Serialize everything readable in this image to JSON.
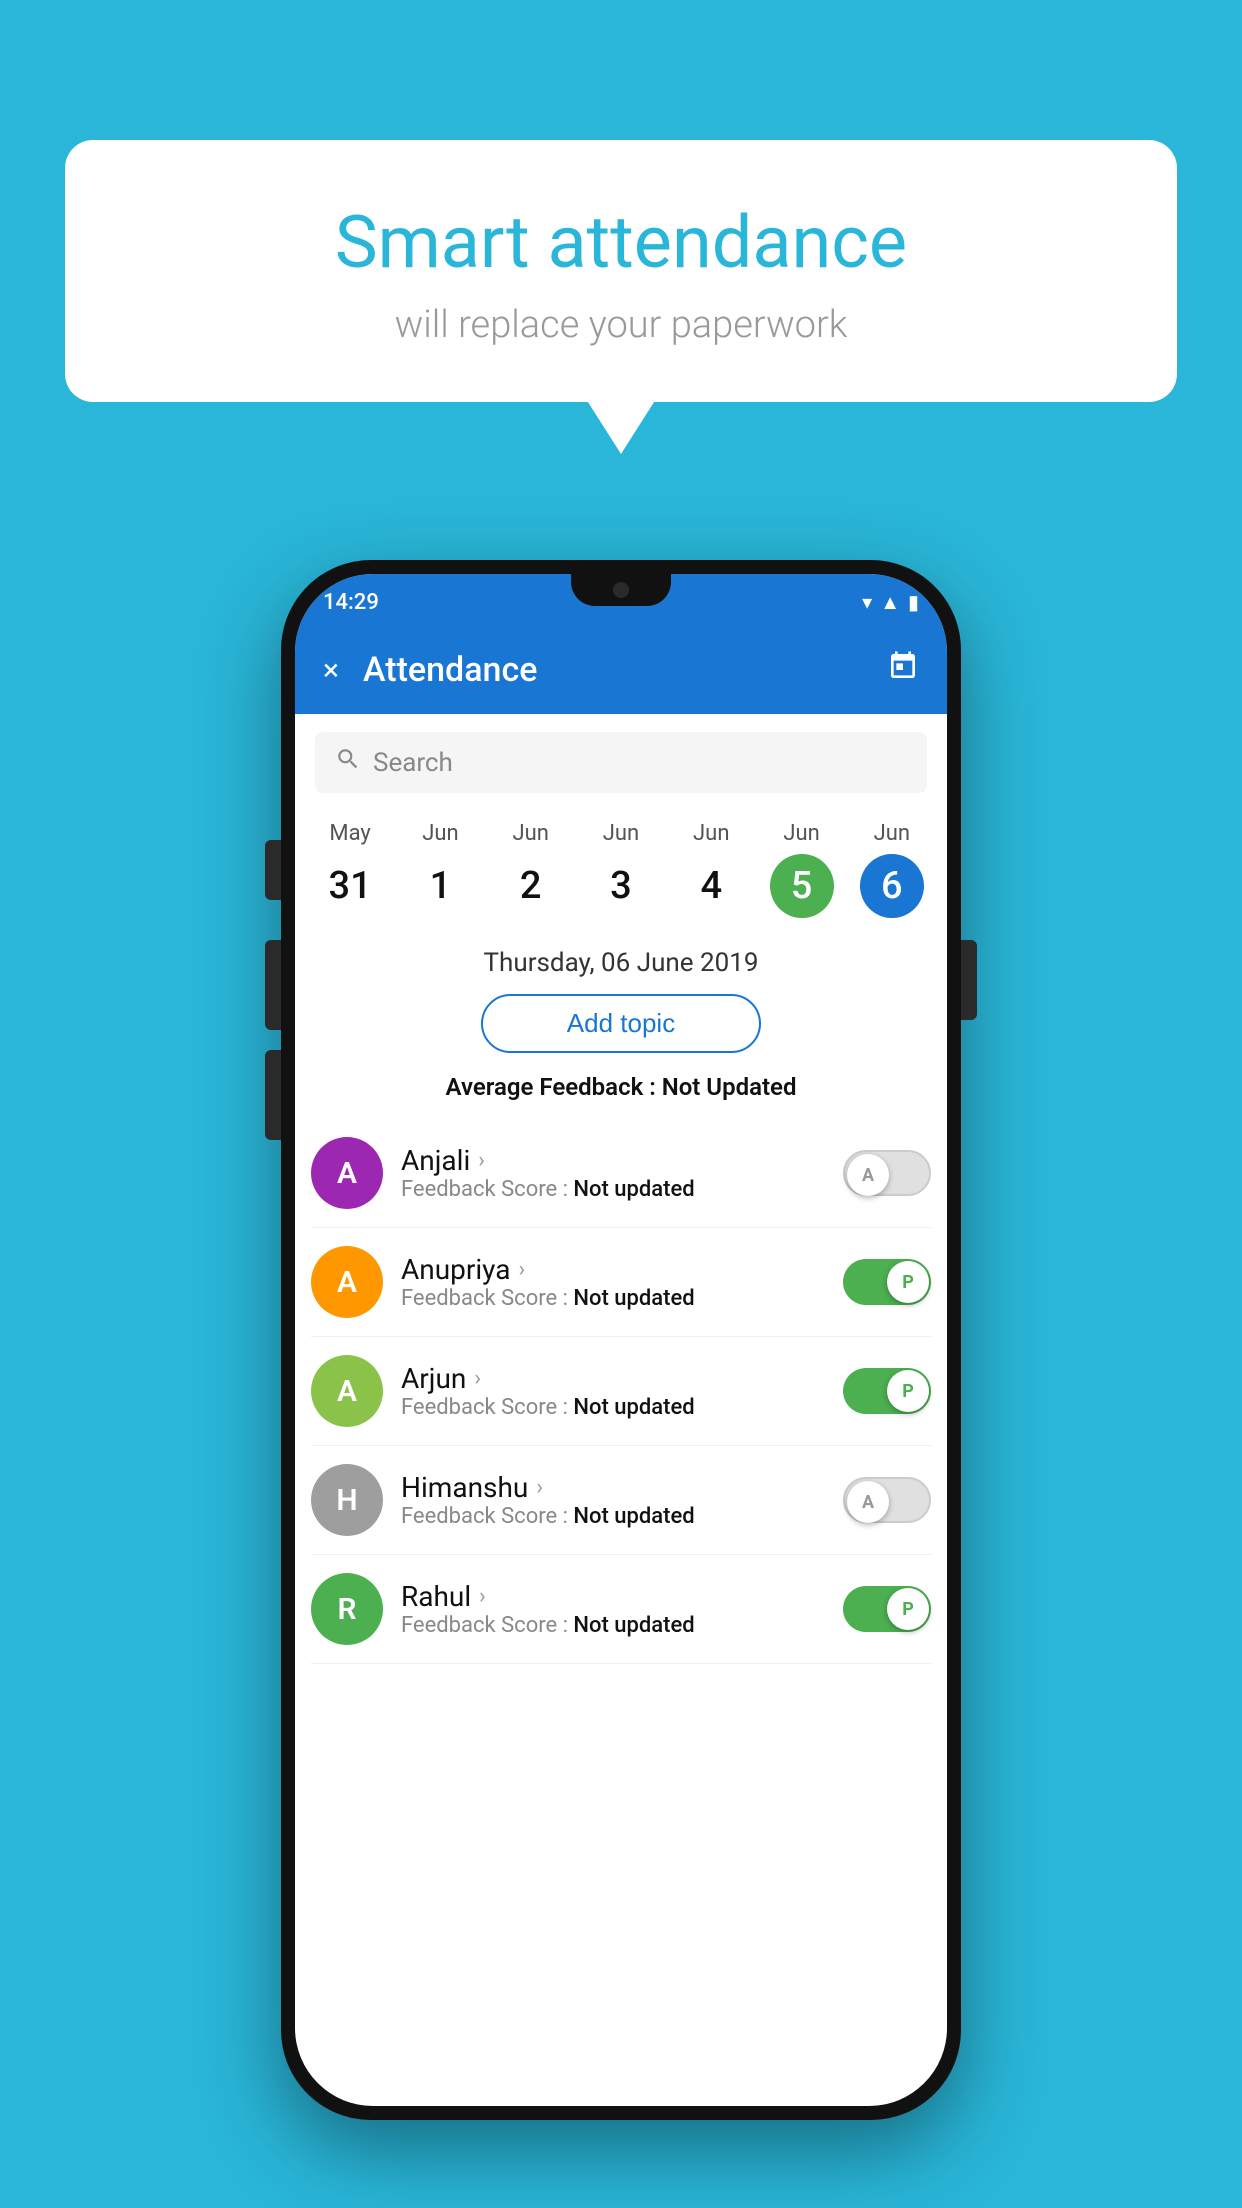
{
  "background_color": "#29b6d8",
  "hero": {
    "title": "Smart attendance",
    "subtitle": "will replace your paperwork"
  },
  "status_bar": {
    "time": "14:29",
    "icons": [
      "wifi",
      "signal",
      "battery"
    ]
  },
  "app_bar": {
    "title": "Attendance",
    "close_label": "×",
    "calendar_label": "📅"
  },
  "search": {
    "placeholder": "Search"
  },
  "calendar": {
    "days": [
      {
        "month": "May",
        "num": "31",
        "style": "normal"
      },
      {
        "month": "Jun",
        "num": "1",
        "style": "normal"
      },
      {
        "month": "Jun",
        "num": "2",
        "style": "normal"
      },
      {
        "month": "Jun",
        "num": "3",
        "style": "normal"
      },
      {
        "month": "Jun",
        "num": "4",
        "style": "normal"
      },
      {
        "month": "Jun",
        "num": "5",
        "style": "green"
      },
      {
        "month": "Jun",
        "num": "6",
        "style": "blue"
      }
    ]
  },
  "selected_date": "Thursday, 06 June 2019",
  "add_topic_label": "Add topic",
  "avg_feedback_label": "Average Feedback : ",
  "avg_feedback_value": "Not Updated",
  "students": [
    {
      "name": "Anjali",
      "avatar_letter": "A",
      "avatar_color": "#9c27b0",
      "feedback_label": "Feedback Score : ",
      "feedback_value": "Not updated",
      "toggle": "off",
      "toggle_letter": "A"
    },
    {
      "name": "Anupriya",
      "avatar_letter": "A",
      "avatar_color": "#ff9800",
      "feedback_label": "Feedback Score : ",
      "feedback_value": "Not updated",
      "toggle": "on",
      "toggle_letter": "P"
    },
    {
      "name": "Arjun",
      "avatar_letter": "A",
      "avatar_color": "#8bc34a",
      "feedback_label": "Feedback Score : ",
      "feedback_value": "Not updated",
      "toggle": "on",
      "toggle_letter": "P"
    },
    {
      "name": "Himanshu",
      "avatar_letter": "H",
      "avatar_color": "#9e9e9e",
      "feedback_label": "Feedback Score : ",
      "feedback_value": "Not updated",
      "toggle": "off",
      "toggle_letter": "A"
    },
    {
      "name": "Rahul",
      "avatar_letter": "R",
      "avatar_color": "#4caf50",
      "feedback_label": "Feedback Score : ",
      "feedback_value": "Not updated",
      "toggle": "on",
      "toggle_letter": "P"
    }
  ]
}
